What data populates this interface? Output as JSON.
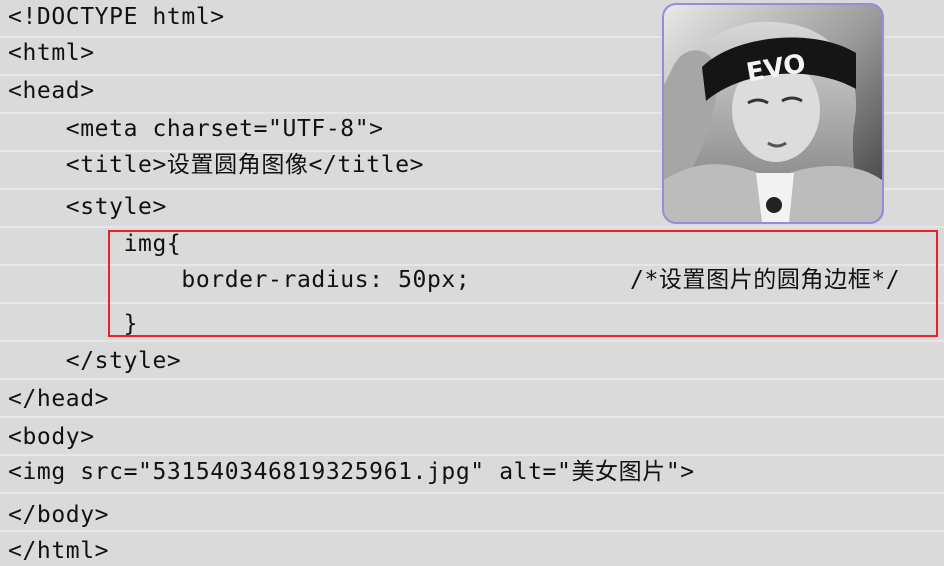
{
  "code": {
    "lines": [
      "<!DOCTYPE html>",
      "<html>",
      "<head>",
      "    <meta charset=\"UTF-8\">",
      "    <title>设置圆角图像</title>",
      "    <style>",
      "        img{",
      "            border-radius: 50px;",
      "/*设置图片的圆角边框*/",
      "        }",
      "    </style>",
      "</head>",
      "<body>",
      "<img src=\"531540346819325961.jpg\" alt=\"美女图片\">",
      "</body>",
      "</html>"
    ]
  },
  "preview": {
    "headband_text": "EVO"
  },
  "colors": {
    "highlight_border": "#e1252b",
    "preview_border": "#8f8fdc",
    "background": "#dadada"
  }
}
